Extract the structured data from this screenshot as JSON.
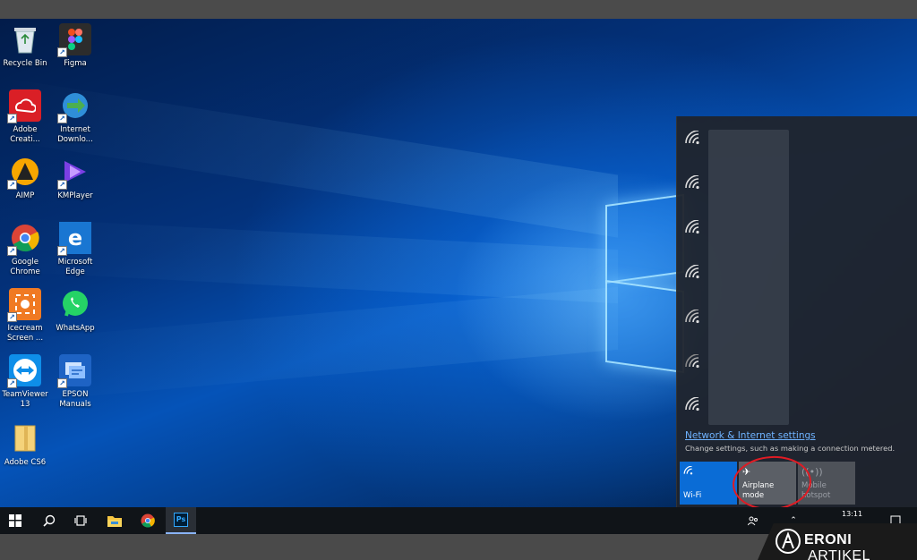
{
  "desktop": {
    "icons": [
      {
        "label": "Recycle Bin",
        "icon": "recycle-bin-icon"
      },
      {
        "label": "Figma",
        "icon": "figma-icon"
      },
      {
        "label": "Adobe\nCreati...",
        "icon": "adobe-creative-cloud-icon"
      },
      {
        "label": "Internet\nDownlo...",
        "icon": "internet-download-manager-icon"
      },
      {
        "label": "AIMP",
        "icon": "aimp-icon"
      },
      {
        "label": "KMPlayer",
        "icon": "kmplayer-icon"
      },
      {
        "label": "Google\nChrome",
        "icon": "chrome-icon"
      },
      {
        "label": "Microsoft\nEdge",
        "icon": "edge-icon"
      },
      {
        "label": "Icecream\nScreen ...",
        "icon": "icecream-screen-icon"
      },
      {
        "label": "WhatsApp",
        "icon": "whatsapp-icon"
      },
      {
        "label": "TeamViewer\n13",
        "icon": "teamviewer-icon"
      },
      {
        "label": "EPSON\nManuals",
        "icon": "epson-manuals-icon"
      },
      {
        "label": "Adobe CS6",
        "icon": "folder-icon"
      }
    ]
  },
  "network_flyout": {
    "settings_link": "Network & Internet settings",
    "settings_desc": "Change settings, such as making a connection metered.",
    "quick_actions": {
      "wifi": "Wi-Fi",
      "airplane": "Airplane mode",
      "hotspot": "Mobile\nhotspot"
    }
  },
  "taskbar": {
    "clock": "13:11"
  },
  "watermark": {
    "brand_bold": "ERONI",
    "brand_rest": " ARTIKEL"
  },
  "colors": {
    "accent": "#0a6cd6",
    "highlight_ring": "#e01b24",
    "link": "#6fb3ff"
  }
}
